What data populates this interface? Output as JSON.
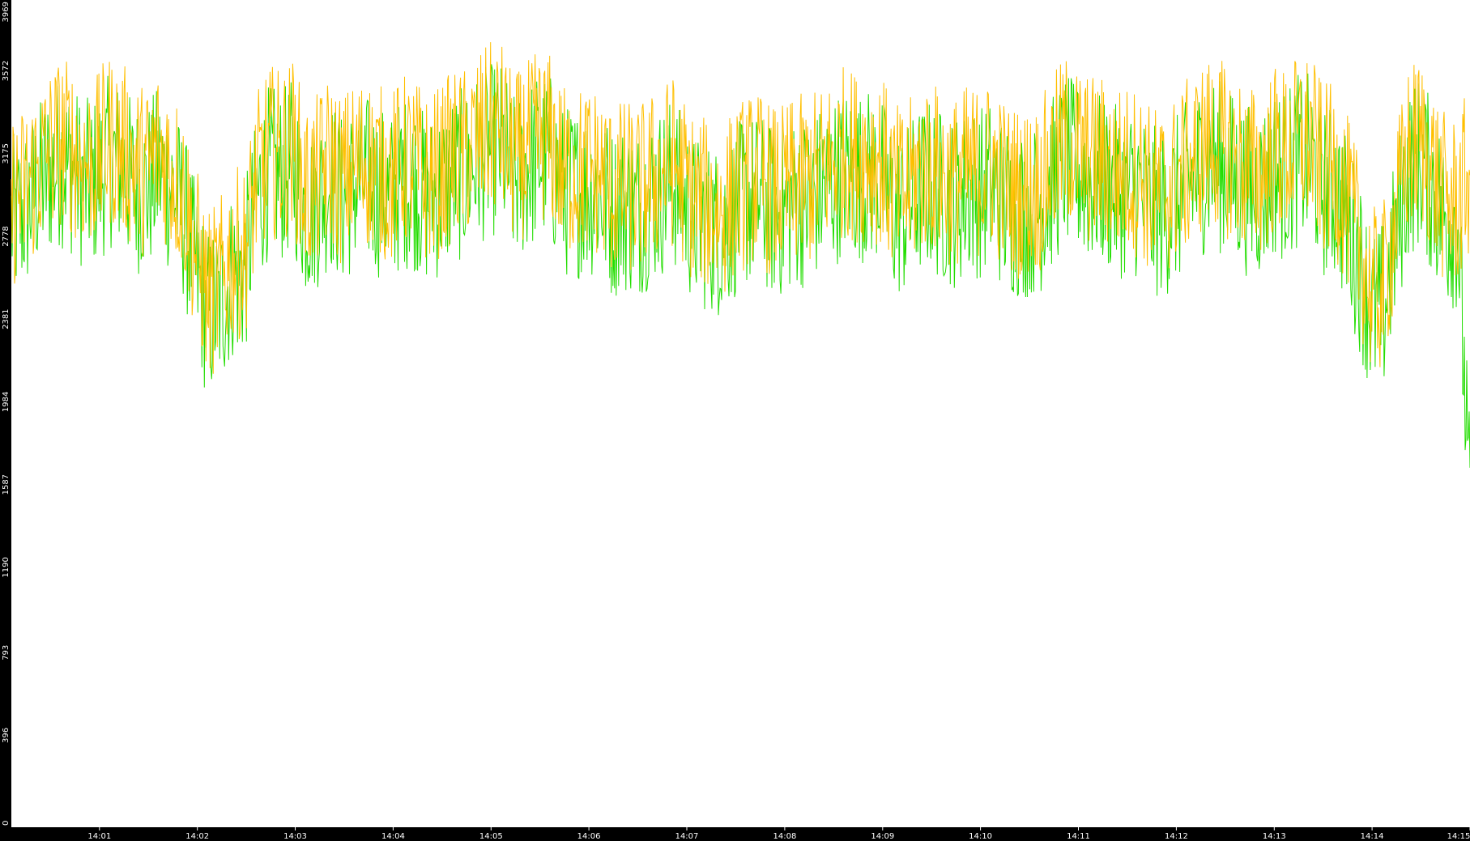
{
  "chart_data": {
    "type": "line",
    "title": "",
    "xlabel": "",
    "ylabel": "",
    "grid": false,
    "legend": "none",
    "ylim": [
      0,
      3969
    ],
    "y_ticks": [
      "0",
      "396",
      "793",
      "1190",
      "1587",
      "1984",
      "2381",
      "2778",
      "3175",
      "3572",
      "3969"
    ],
    "x_ticks": [
      "14:01",
      "14:02",
      "14:03",
      "14:04",
      "14:05",
      "14:06",
      "14:07",
      "14:08",
      "14:09",
      "14:10",
      "14:11",
      "14:12",
      "14:13",
      "14:14",
      "14:15"
    ],
    "x_range": [
      "14:00:06",
      "14:15:00"
    ],
    "series": [
      {
        "color": "#ffbf00",
        "values": [
          3000,
          3050,
          3150,
          3230,
          3300,
          3250,
          3180,
          3200,
          3300,
          3260,
          3180,
          3150,
          3250,
          3170,
          3050,
          2780,
          2550,
          2600,
          2750,
          2750,
          3100,
          3250,
          3220,
          3280,
          3050,
          3100,
          3200,
          3100,
          3180,
          3200,
          3150,
          3120,
          3200,
          3180,
          3100,
          3150,
          3220,
          3230,
          3300,
          3350,
          3350,
          3200,
          3250,
          3320,
          3300,
          3150,
          3150,
          3150,
          3150,
          3050,
          3080,
          3050,
          3100,
          3150,
          3200,
          3080,
          3000,
          2980,
          2950,
          3050,
          3100,
          3120,
          3050,
          3050,
          3100,
          3100,
          3150,
          3200,
          3250,
          3220,
          3230,
          3200,
          3050,
          3050,
          3150,
          3180,
          3120,
          3100,
          3150,
          3150,
          3180,
          3080,
          3050,
          3050,
          3080,
          3200,
          3300,
          3250,
          3200,
          3200,
          3150,
          3150,
          3150,
          3050,
          3050,
          3100,
          3180,
          3250,
          3300,
          3250,
          3200,
          3150,
          3150,
          3250,
          3230,
          3300,
          3300,
          3150,
          3150,
          3000,
          2800,
          2550,
          2600,
          2950,
          3250,
          3300,
          3150,
          3000,
          3000,
          3150
        ]
      },
      {
        "color": "#22dd00",
        "values": [
          2900,
          2950,
          3050,
          3130,
          3200,
          3150,
          3080,
          3100,
          3200,
          3160,
          3080,
          3050,
          3150,
          3070,
          2950,
          2680,
          2450,
          2500,
          2650,
          2650,
          3000,
          3150,
          3120,
          3180,
          2950,
          3000,
          3100,
          3000,
          3080,
          3100,
          3050,
          3020,
          3100,
          3080,
          3000,
          3050,
          3120,
          3130,
          3200,
          3250,
          3250,
          3100,
          3150,
          3220,
          3200,
          3050,
          3050,
          3050,
          3050,
          2950,
          2980,
          2950,
          3000,
          3050,
          3100,
          2980,
          2900,
          2880,
          2850,
          2950,
          3000,
          3020,
          2950,
          2950,
          3000,
          3000,
          3050,
          3100,
          3150,
          3120,
          3130,
          3100,
          2950,
          2950,
          3050,
          3080,
          3020,
          3000,
          3050,
          3050,
          3080,
          2980,
          2950,
          2950,
          2980,
          3100,
          3200,
          3150,
          3100,
          3100,
          3050,
          3050,
          3050,
          2950,
          2950,
          3000,
          3080,
          3150,
          3200,
          3150,
          3100,
          3050,
          3050,
          3150,
          3130,
          3200,
          3200,
          3050,
          3050,
          2900,
          2700,
          2450,
          2500,
          2850,
          3150,
          3200,
          3050,
          2900,
          2900,
          1500
        ]
      }
    ]
  }
}
